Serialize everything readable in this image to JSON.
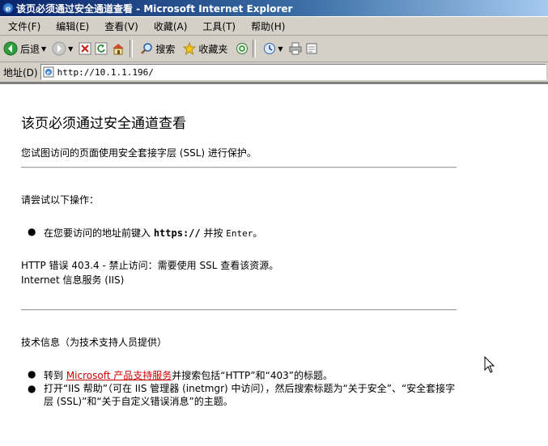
{
  "window": {
    "title": "该页必须通过安全通道查看 - Microsoft Internet Explorer"
  },
  "menubar": {
    "items": [
      {
        "label": "文件(F)"
      },
      {
        "label": "编辑(E)"
      },
      {
        "label": "查看(V)"
      },
      {
        "label": "收藏(A)"
      },
      {
        "label": "工具(T)"
      },
      {
        "label": "帮助(H)"
      }
    ]
  },
  "toolbar": {
    "back_label": "后退",
    "search_label": "搜索",
    "favorites_label": "收藏夹"
  },
  "address": {
    "label": "地址(D)",
    "url": "http://10.1.1.196/"
  },
  "page": {
    "title": "该页必须通过安全通道查看",
    "intro": "您试图访问的页面使用安全套接字层 (SSL) 进行保护。",
    "try_heading": "请尝试以下操作：",
    "bullet1_prefix": "在您要访问的地址前键入 ",
    "bullet1_code": "https://",
    "bullet1_mid": " 并按 ",
    "bullet1_key": "Enter",
    "bullet1_end": "。",
    "error_line1": "HTTP 错误 403.4 - 禁止访问：需要使用 SSL 查看该资源。",
    "error_line2": "Internet 信息服务 (IIS)",
    "tech_heading": "技术信息（为技术支持人员提供）",
    "bullet2_prefix": "转到 ",
    "bullet2_link": "Microsoft 产品支持服务",
    "bullet2_suffix": "并搜索包括“HTTP”和“403”的标题。",
    "bullet3": "打开“IIS 帮助”（可在 IIS 管理器 (inetmgr) 中访问），然后搜索标题为“关于安全”、“安全套接字层 (SSL)”和“关于自定义错误消息”的主题。"
  },
  "colors": {
    "titlebar_start": "#0a246a",
    "chrome": "#d4d0c8",
    "link": "#cc0000"
  }
}
